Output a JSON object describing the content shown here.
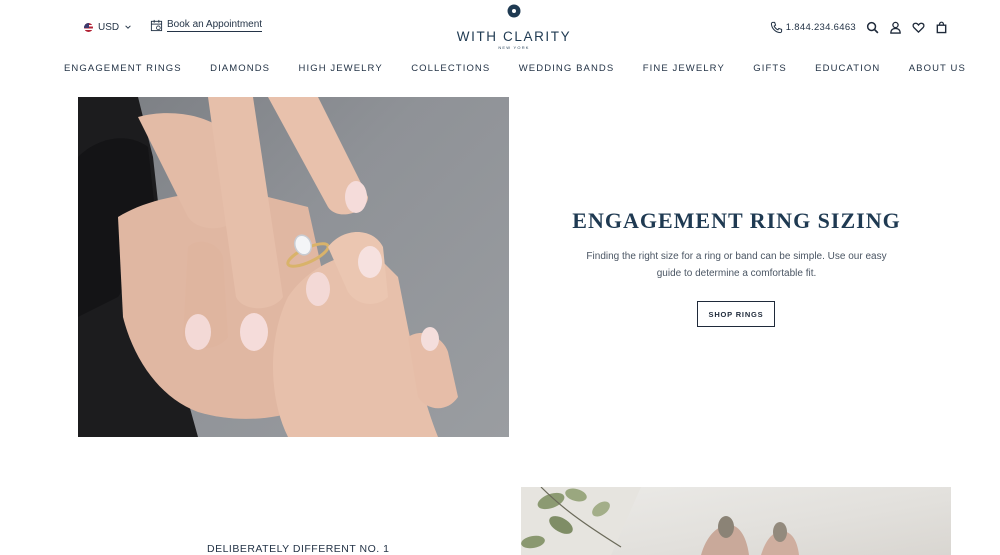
{
  "header": {
    "currency": "USD",
    "appointment_label": "Book an Appointment",
    "brand_name": "WITH CLARITY",
    "brand_sub": "NEW YORK",
    "phone": "1.844.234.6463",
    "icons": [
      "phone-icon",
      "search-icon",
      "account-icon",
      "wishlist-heart-icon",
      "cart-icon"
    ]
  },
  "nav": {
    "items": [
      "ENGAGEMENT RINGS",
      "DIAMONDS",
      "HIGH JEWELRY",
      "COLLECTIONS",
      "WEDDING BANDS",
      "FINE JEWELRY",
      "GIFTS",
      "EDUCATION",
      "ABOUT US"
    ]
  },
  "hero": {
    "title": "ENGAGEMENT RING SIZING",
    "text": "Finding the right size for a ring or band can be simple. Use our easy guide to determine a comfortable fit.",
    "button": "SHOP RINGS"
  },
  "section2": {
    "heading": "DELIBERATELY DIFFERENT NO. 1"
  },
  "colors": {
    "navy": "#1f3a52",
    "text": "#243447",
    "hero_bg": "#8f9297"
  }
}
